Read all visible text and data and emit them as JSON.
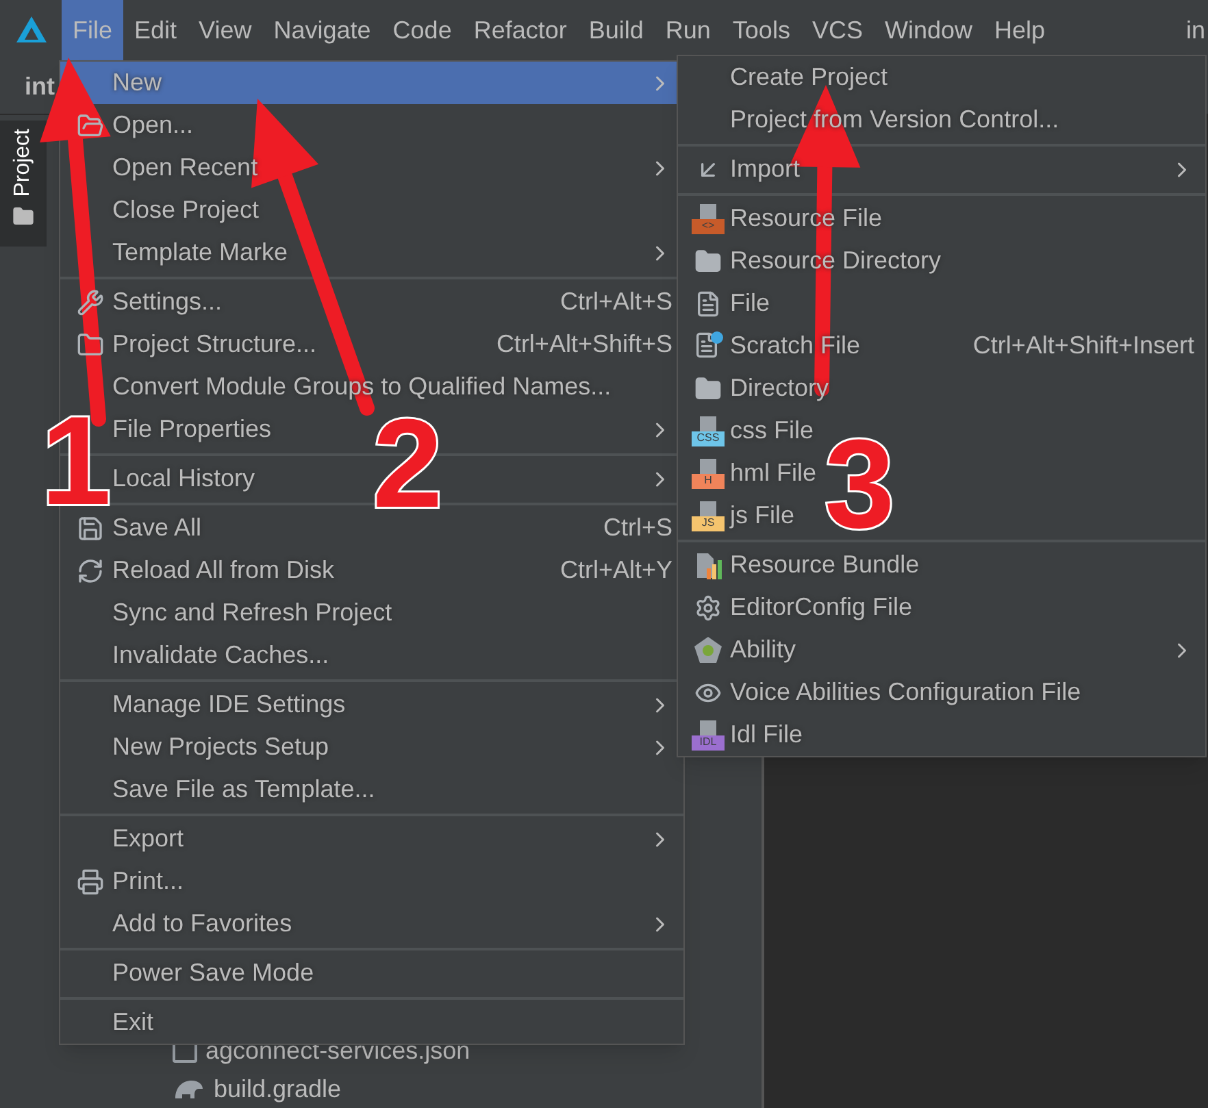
{
  "menubar": [
    {
      "label": "File",
      "selected": true
    },
    {
      "label": "Edit",
      "selected": false
    },
    {
      "label": "View",
      "selected": false
    },
    {
      "label": "Navigate",
      "selected": false
    },
    {
      "label": "Code",
      "selected": false
    },
    {
      "label": "Refactor",
      "selected": false
    },
    {
      "label": "Build",
      "selected": false
    },
    {
      "label": "Run",
      "selected": false
    },
    {
      "label": "Tools",
      "selected": false
    },
    {
      "label": "VCS",
      "selected": false
    },
    {
      "label": "Window",
      "selected": false
    },
    {
      "label": "Help",
      "selected": false
    }
  ],
  "window_title": "in",
  "project_panel": {
    "tab": {
      "label": "Project",
      "selected": true
    },
    "header": "int",
    "tree": [
      {
        "label": "agconnect-services.json"
      },
      {
        "label": "build.gradle"
      }
    ]
  },
  "file_menu": [
    {
      "kind": "item",
      "label": "New",
      "selected": true,
      "submenu": true
    },
    {
      "kind": "item",
      "label": "Open...",
      "selected": false
    },
    {
      "kind": "item",
      "label": "Open Recent",
      "selected": false,
      "submenu": true
    },
    {
      "kind": "item",
      "label": "Close Project",
      "selected": false
    },
    {
      "kind": "item",
      "label": "Template Marke",
      "selected": false,
      "submenu": true
    },
    {
      "kind": "separator"
    },
    {
      "kind": "item",
      "label": "Settings...",
      "selected": false,
      "shortcut": "Ctrl+Alt+S"
    },
    {
      "kind": "item",
      "label": "Project Structure...",
      "selected": false,
      "shortcut": "Ctrl+Alt+Shift+S"
    },
    {
      "kind": "item",
      "label": "Convert Module Groups to Qualified Names...",
      "selected": false
    },
    {
      "kind": "item",
      "label": "File Properties",
      "selected": false,
      "submenu": true
    },
    {
      "kind": "separator"
    },
    {
      "kind": "item",
      "label": "Local History",
      "selected": false,
      "submenu": true
    },
    {
      "kind": "separator"
    },
    {
      "kind": "item",
      "label": "Save All",
      "selected": false,
      "shortcut": "Ctrl+S"
    },
    {
      "kind": "item",
      "label": "Reload All from Disk",
      "selected": false,
      "shortcut": "Ctrl+Alt+Y"
    },
    {
      "kind": "item",
      "label": "Sync and Refresh Project",
      "selected": false
    },
    {
      "kind": "item",
      "label": "Invalidate Caches...",
      "selected": false
    },
    {
      "kind": "separator"
    },
    {
      "kind": "item",
      "label": "Manage IDE Settings",
      "selected": false,
      "submenu": true
    },
    {
      "kind": "item",
      "label": "New Projects Setup",
      "selected": false,
      "submenu": true
    },
    {
      "kind": "item",
      "label": "Save File as Template...",
      "selected": false
    },
    {
      "kind": "separator"
    },
    {
      "kind": "item",
      "label": "Export",
      "selected": false,
      "submenu": true
    },
    {
      "kind": "item",
      "label": "Print...",
      "selected": false
    },
    {
      "kind": "item",
      "label": "Add to Favorites",
      "selected": false,
      "submenu": true
    },
    {
      "kind": "separator"
    },
    {
      "kind": "item",
      "label": "Power Save Mode",
      "selected": false
    },
    {
      "kind": "separator"
    },
    {
      "kind": "item",
      "label": "Exit",
      "selected": false
    }
  ],
  "new_submenu": [
    {
      "kind": "item",
      "label": "Create Project",
      "selected": false
    },
    {
      "kind": "item",
      "label": "Project from Version Control...",
      "selected": false
    },
    {
      "kind": "separator"
    },
    {
      "kind": "item",
      "label": "Import",
      "selected": false,
      "submenu": true
    },
    {
      "kind": "separator"
    },
    {
      "kind": "item",
      "label": "Resource File",
      "selected": false,
      "badge": "<>",
      "color": "#c75b2a"
    },
    {
      "kind": "item",
      "label": "Resource Directory",
      "selected": false
    },
    {
      "kind": "item",
      "label": "File",
      "selected": false
    },
    {
      "kind": "item",
      "label": "Scratch File",
      "selected": false,
      "shortcut": "Ctrl+Alt+Shift+Insert"
    },
    {
      "kind": "item",
      "label": "Directory",
      "selected": false
    },
    {
      "kind": "item",
      "label": "css File",
      "selected": false,
      "badge": "CSS",
      "color": "#6ec5e9"
    },
    {
      "kind": "item",
      "label": "hml File",
      "selected": false,
      "badge": "H",
      "color": "#f0845a"
    },
    {
      "kind": "item",
      "label": "js File",
      "selected": false,
      "badge": "JS",
      "color": "#f5c46e"
    },
    {
      "kind": "separator"
    },
    {
      "kind": "item",
      "label": "Resource Bundle",
      "selected": false
    },
    {
      "kind": "item",
      "label": "EditorConfig File",
      "selected": false
    },
    {
      "kind": "item",
      "label": "Ability",
      "selected": false,
      "submenu": true
    },
    {
      "kind": "item",
      "label": "Voice Abilities Configuration File",
      "selected": false
    },
    {
      "kind": "item",
      "label": "Idl File",
      "selected": false,
      "badge": "IDL",
      "color": "#9b6fcf"
    }
  ],
  "annotations": [
    {
      "number": "1"
    },
    {
      "number": "2"
    },
    {
      "number": "3"
    }
  ]
}
